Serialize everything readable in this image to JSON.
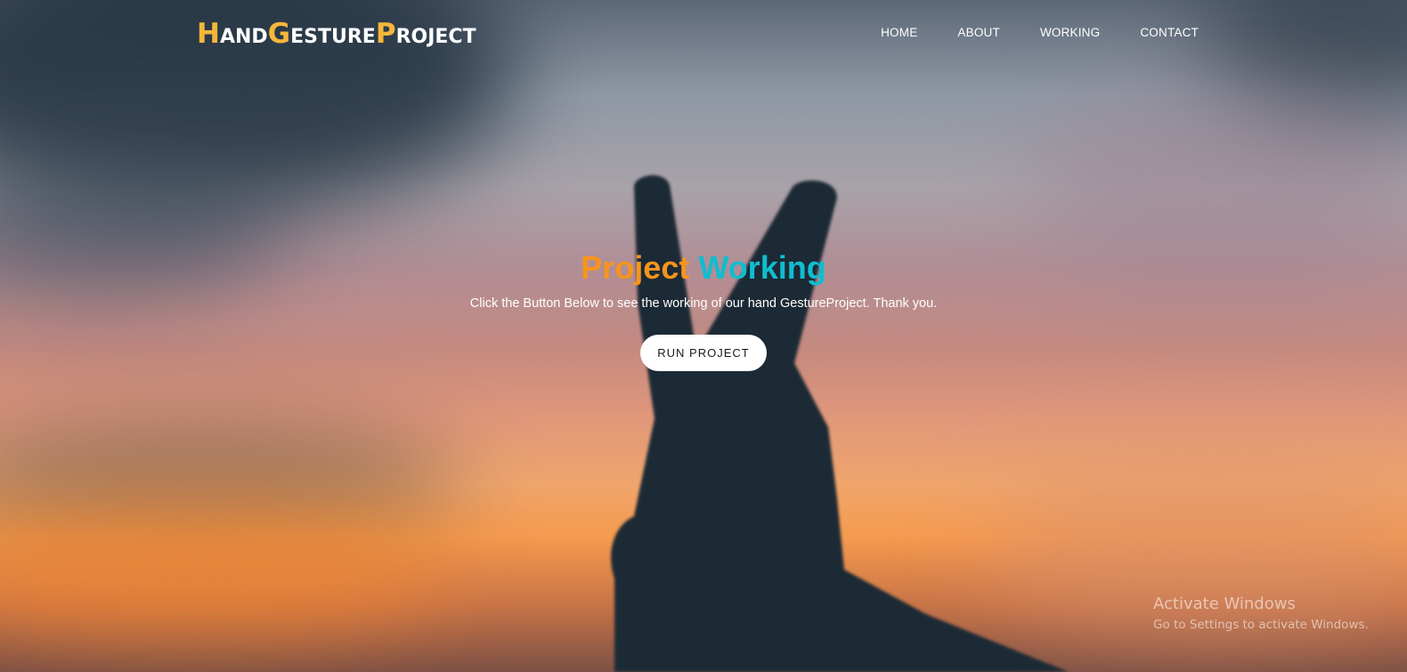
{
  "logo": {
    "h_cap": "H",
    "h_rest": "AND",
    "g_cap": "G",
    "g_rest": "ESTURE",
    "p_cap": "P",
    "p_rest": "ROJECT"
  },
  "nav": {
    "items": [
      {
        "label": "HOME"
      },
      {
        "label": "ABOUT"
      },
      {
        "label": "WORKING"
      },
      {
        "label": "CONTACT"
      }
    ]
  },
  "hero": {
    "title_word1": "Project",
    "title_word2": "Working",
    "subtitle": "Click the Button Below to see the working of our hand GestureProject. Thank you.",
    "button_label": "RUN PROJECT"
  },
  "watermark": {
    "title": "Activate Windows",
    "subtitle": "Go to Settings to activate Windows."
  },
  "colors": {
    "logo_accent": "#f5b63a",
    "title_orange": "#f7941d",
    "title_cyan": "#10bdd0",
    "nav_text": "#ffffff",
    "button_bg": "#ffffff"
  },
  "icons": {
    "hero_image": "hand-peace-sign-silhouette-sunset"
  }
}
